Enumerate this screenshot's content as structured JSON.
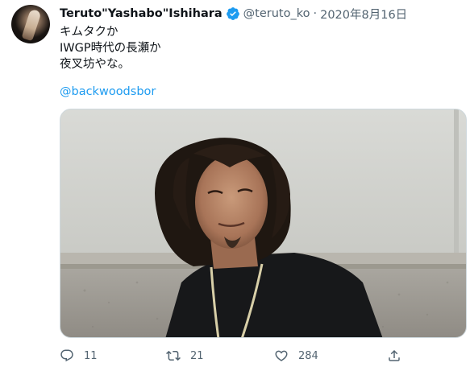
{
  "tweet": {
    "display_name": "Teruto\"Yashabo\"Ishihara",
    "handle": "@teruto_ko",
    "separator": "·",
    "date": "2020年8月16日",
    "text_lines": [
      "キムタクか",
      "IWGP時代の長瀬か",
      "夜叉坊やな。"
    ],
    "mention": "@backwoodsbor"
  },
  "actions": {
    "reply_count": "11",
    "retweet_count": "21",
    "like_count": "284"
  },
  "icons": {
    "verified": "verified-badge-icon",
    "reply": "reply-icon",
    "retweet": "retweet-icon",
    "like": "heart-icon",
    "share": "share-icon"
  },
  "colors": {
    "text": "#0f1419",
    "secondary": "#536471",
    "link": "#1d9bf0",
    "verified": "#1d9bf0"
  }
}
